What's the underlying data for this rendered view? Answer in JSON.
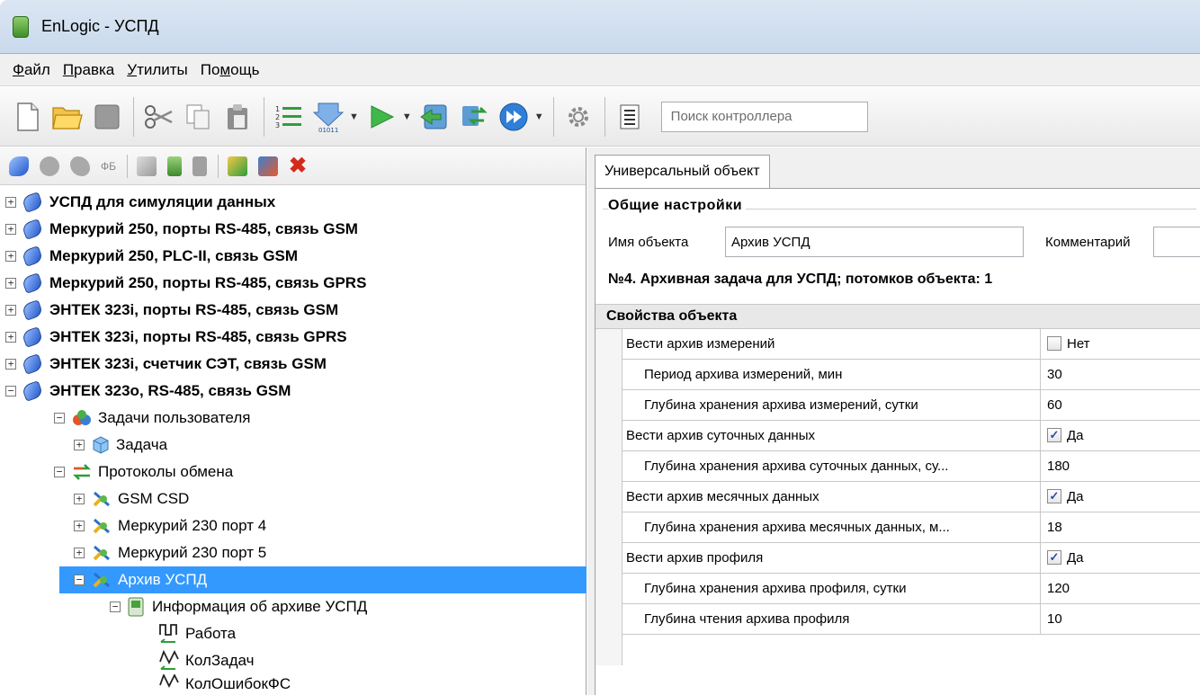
{
  "window": {
    "title": "EnLogic - УСПД"
  },
  "menu": [
    {
      "label": "Файл"
    },
    {
      "label": "Правка"
    },
    {
      "label": "Утилиты"
    },
    {
      "label": "Помощь"
    }
  ],
  "toolbar": {
    "search_placeholder": "Поиск контроллера"
  },
  "tree": {
    "items": [
      {
        "label": "УСПД для симуляции данных"
      },
      {
        "label": "Меркурий 250, порты RS-485, связь GSM"
      },
      {
        "label": "Меркурий 250, PLC-II, связь GSM"
      },
      {
        "label": "Меркурий 250, порты RS-485, связь GPRS"
      },
      {
        "label": "ЭНТЕК 323i, порты RS-485, связь GSM"
      },
      {
        "label": "ЭНТЕК 323i, порты RS-485, связь GPRS"
      },
      {
        "label": "ЭНТЕК 323i, счетчик СЭТ, связь GSM"
      },
      {
        "label": "ЭНТЕК 323o, RS-485, связь GSM"
      },
      {
        "label": "Задачи пользователя"
      },
      {
        "label": "Задача"
      },
      {
        "label": "Протоколы обмена"
      },
      {
        "label": "GSM CSD"
      },
      {
        "label": "Меркурий 230 порт 4"
      },
      {
        "label": "Меркурий 230 порт 5"
      },
      {
        "label": "Архив УСПД"
      },
      {
        "label": "Информация об архиве УСПД"
      },
      {
        "label": "Работа"
      },
      {
        "label": "КолЗадач"
      },
      {
        "label": "КолОшибокФС"
      }
    ]
  },
  "right": {
    "tab": "Универсальный объект",
    "general": {
      "title": "Общие настройки",
      "name_label": "Имя объекта",
      "name_value": "Архив УСПД",
      "comment_label": "Комментарий",
      "comment_value": "",
      "info": "№4. Архивная задача для УСПД; потомков объекта: 1"
    },
    "props_title": "Свойства объекта",
    "props": [
      {
        "name": "Вести архив измерений",
        "value": "Нет",
        "checkbox": true,
        "checked": false
      },
      {
        "name": "Период архива измерений, мин",
        "value": "30"
      },
      {
        "name": "Глубина хранения архива измерений, сутки",
        "value": "60"
      },
      {
        "name": "Вести архив суточных данных",
        "value": "Да",
        "checkbox": true,
        "checked": true
      },
      {
        "name": "Глубина хранения архива суточных данных, су...",
        "value": "180"
      },
      {
        "name": "Вести архив месячных данных",
        "value": "Да",
        "checkbox": true,
        "checked": true
      },
      {
        "name": "Глубина хранения архива месячных данных, м...",
        "value": "18"
      },
      {
        "name": "Вести архив профиля",
        "value": "Да",
        "checkbox": true,
        "checked": true
      },
      {
        "name": "Глубина хранения архива профиля, сутки",
        "value": "120"
      },
      {
        "name": "Глубина чтения архива профиля",
        "value": "10"
      }
    ]
  }
}
